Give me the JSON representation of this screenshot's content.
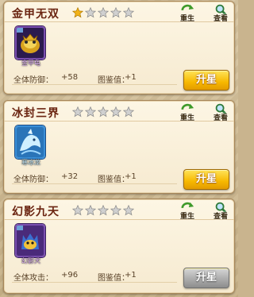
{
  "colors": {
    "title": "#6a2410",
    "star_gold": "#f2b318",
    "star_empty": "#cfcfcf",
    "upgrade_gold": "#f7b800",
    "upgrade_disabled": "#a9a9a9"
  },
  "cards": [
    {
      "title": "金甲无双",
      "stars_filled": 1,
      "stars_total": 5,
      "rebirth_label": "重生",
      "view_label": "查看",
      "pet_name": "金甲龟",
      "stat_label": "全体防御：",
      "stat_value": "+58",
      "book_label": "图鉴值：",
      "book_value": "+1",
      "upgrade_label": "升星",
      "upgrade_enabled": true
    },
    {
      "title": "冰封三界",
      "stars_filled": 0,
      "stars_total": 5,
      "rebirth_label": "重生",
      "view_label": "查看",
      "pet_name": "寒冰龙",
      "stat_label": "全体防御：",
      "stat_value": "+32",
      "book_label": "图鉴值：",
      "book_value": "+1",
      "upgrade_label": "升星",
      "upgrade_enabled": true
    },
    {
      "title": "幻影九天",
      "stars_filled": 0,
      "stars_total": 5,
      "rebirth_label": "重生",
      "view_label": "查看",
      "pet_name": "幻影犬",
      "stat_label": "全体攻击：",
      "stat_value": "+96",
      "book_label": "图鉴值：",
      "book_value": "+1",
      "upgrade_label": "升星",
      "upgrade_enabled": false
    }
  ]
}
